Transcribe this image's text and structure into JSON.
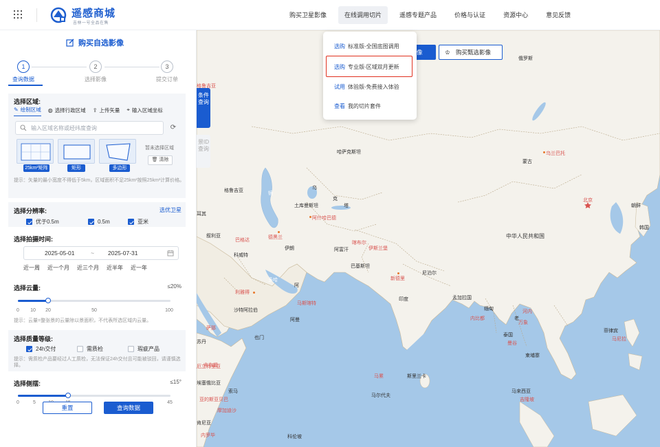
{
  "header": {
    "brand_name": "遥感商城",
    "brand_slogan": "吉林一号全品在售",
    "nav": [
      {
        "label": "购买卫星影像",
        "active": false
      },
      {
        "label": "在线调用切片",
        "active": true
      },
      {
        "label": "遥感专题产品",
        "active": false
      },
      {
        "label": "价格与认证",
        "active": false
      },
      {
        "label": "资源中心",
        "active": false
      },
      {
        "label": "意见反馈",
        "active": false
      }
    ]
  },
  "sidebar": {
    "title": "购买自选影像",
    "steps": [
      {
        "num": "1",
        "label": "查询数据"
      },
      {
        "num": "2",
        "label": "选择影像"
      },
      {
        "num": "3",
        "label": "提交订单"
      }
    ],
    "area": {
      "title": "选择区域:",
      "tabs": [
        "绘制区域",
        "选择行政区域",
        "上传矢量",
        "输入区域坐标"
      ],
      "search_placeholder": "输入区域名称或经纬度查询",
      "shapes": [
        "25km²矩阵",
        "矩形",
        "多边形"
      ],
      "no_selection": "暂未选择区域",
      "clear_label": "清除",
      "hint": "提示：矢量的最小宽度不得低于5km，区域面积不足25km²按照25km²计算价格。"
    },
    "resolution": {
      "title": "选择分辨率:",
      "link": "选优卫星",
      "options": [
        {
          "label": "优于0.5m",
          "checked": true
        },
        {
          "label": "0.5m",
          "checked": true
        },
        {
          "label": "亚米",
          "checked": true
        }
      ]
    },
    "time": {
      "title": "选择拍摄时间:",
      "start": "2025-05-01",
      "sep": "~",
      "end": "2025-07-31",
      "quick": [
        "近一周",
        "近一个月",
        "近三个月",
        "近半年",
        "近一年"
      ]
    },
    "cloud": {
      "title": "选择云量:",
      "value_label": "≤20%",
      "value": 20,
      "ticks": [
        "0",
        "10",
        "20",
        "50",
        "100"
      ],
      "hint": "提示：云量=整张景的云量除以景面积，不代表所选区域内云量。"
    },
    "quality": {
      "title": "选择质量等级:",
      "options": [
        {
          "label": "24h交付",
          "checked": true
        },
        {
          "label": "需质检",
          "checked": false
        },
        {
          "label": "瑕疵产品",
          "checked": false
        }
      ],
      "hint": "提示：需质检产品要经过人工质检，无法保证24h交付且可能被驳回，请谨慎选择。"
    },
    "tilt": {
      "title": "选择侧摆:",
      "value_label": "≤15°",
      "value": 15,
      "ticks": [
        "0",
        "5",
        "10",
        "15",
        "45"
      ]
    },
    "reset_label": "重置",
    "query_label": "查询数据"
  },
  "map": {
    "side_tab_active": "条件查询",
    "side_tab_inactive": "景ID查询",
    "buy_partial": "像",
    "buy_selected_label": "购买甄选影像",
    "labels": {
      "russia": "俄罗斯",
      "kazakhstan": "哈萨克斯坦",
      "mongolia": "蒙古",
      "ulaanbaatar": "乌兰巴托",
      "china": "中华人民共和国",
      "beijing": "北京",
      "korea": "朝鲜",
      "south_korea": "韩国",
      "georgia": "格鲁吉亚",
      "turkey": "耳其",
      "turkmenistan": "土库曼斯坦",
      "ashgabat": "阿什哈巴德",
      "uzbek": "乌",
      "kyrgyz": "克",
      "tajik": "塔",
      "iraq": "叙利亚",
      "baghdad": "巴格达",
      "tehran": "德黑兰",
      "iran": "伊朗",
      "kuwait": "科威特",
      "afghanistan": "阿富汗",
      "kabul": "喀布尔",
      "islamabad": "伊斯兰堡",
      "pakistan": "巴基斯坦",
      "nepal": "尼泊尔",
      "new_delhi": "新德里",
      "doha": "多哈",
      "riyadh": "利雅得",
      "oman": "阿",
      "muscat": "马斯喀特",
      "saudi": "沙特阿拉伯",
      "india": "印度",
      "bangladesh": "孟加拉国",
      "myanmar": "缅甸",
      "naypyidaw": "内比都",
      "laos": "老",
      "hanoi": "河内",
      "vientiane": "万象",
      "thailand": "泰国",
      "bangkok": "曼谷",
      "cambodia": "柬埔寨",
      "philippines": "菲律宾",
      "manila": "马尼拉",
      "sudan": "苏丹",
      "eritrea": "厄立特里亚",
      "yemen": "也门",
      "sanaa": "萨那",
      "oman2": "阿曼",
      "djibouti": "吉布提",
      "ethiopia": "埃塞俄比亚",
      "somalia": "索马",
      "addis": "亚的斯亚贝巴",
      "mogadishu": "摩加迪沙",
      "kenya": "肯尼亚",
      "nairobi": "内罗毕",
      "male": "马累",
      "maldives": "马尔代夫",
      "sri_lanka": "斯里兰卡",
      "colombo": "科伦坡",
      "malaysia": "马来西亚",
      "kuala": "吉隆坡",
      "mirror": "镜",
      "islamabad_red": "伊斯兰堡",
      "baku": "巴库"
    }
  },
  "dropdown": {
    "items": [
      {
        "tag": "选购",
        "text": "标准版-全国底图调用"
      },
      {
        "tag": "选购",
        "text": "专业版-区域双月更新"
      },
      {
        "tag": "试用",
        "text": "体验版-免费接入体验"
      },
      {
        "tag": "查看",
        "text": "我的切片套件"
      }
    ]
  },
  "colors": {
    "primary": "#1a5cd0",
    "highlight": "#e0301e",
    "land": "#f4f2ec",
    "water": "#a5c8e8"
  }
}
